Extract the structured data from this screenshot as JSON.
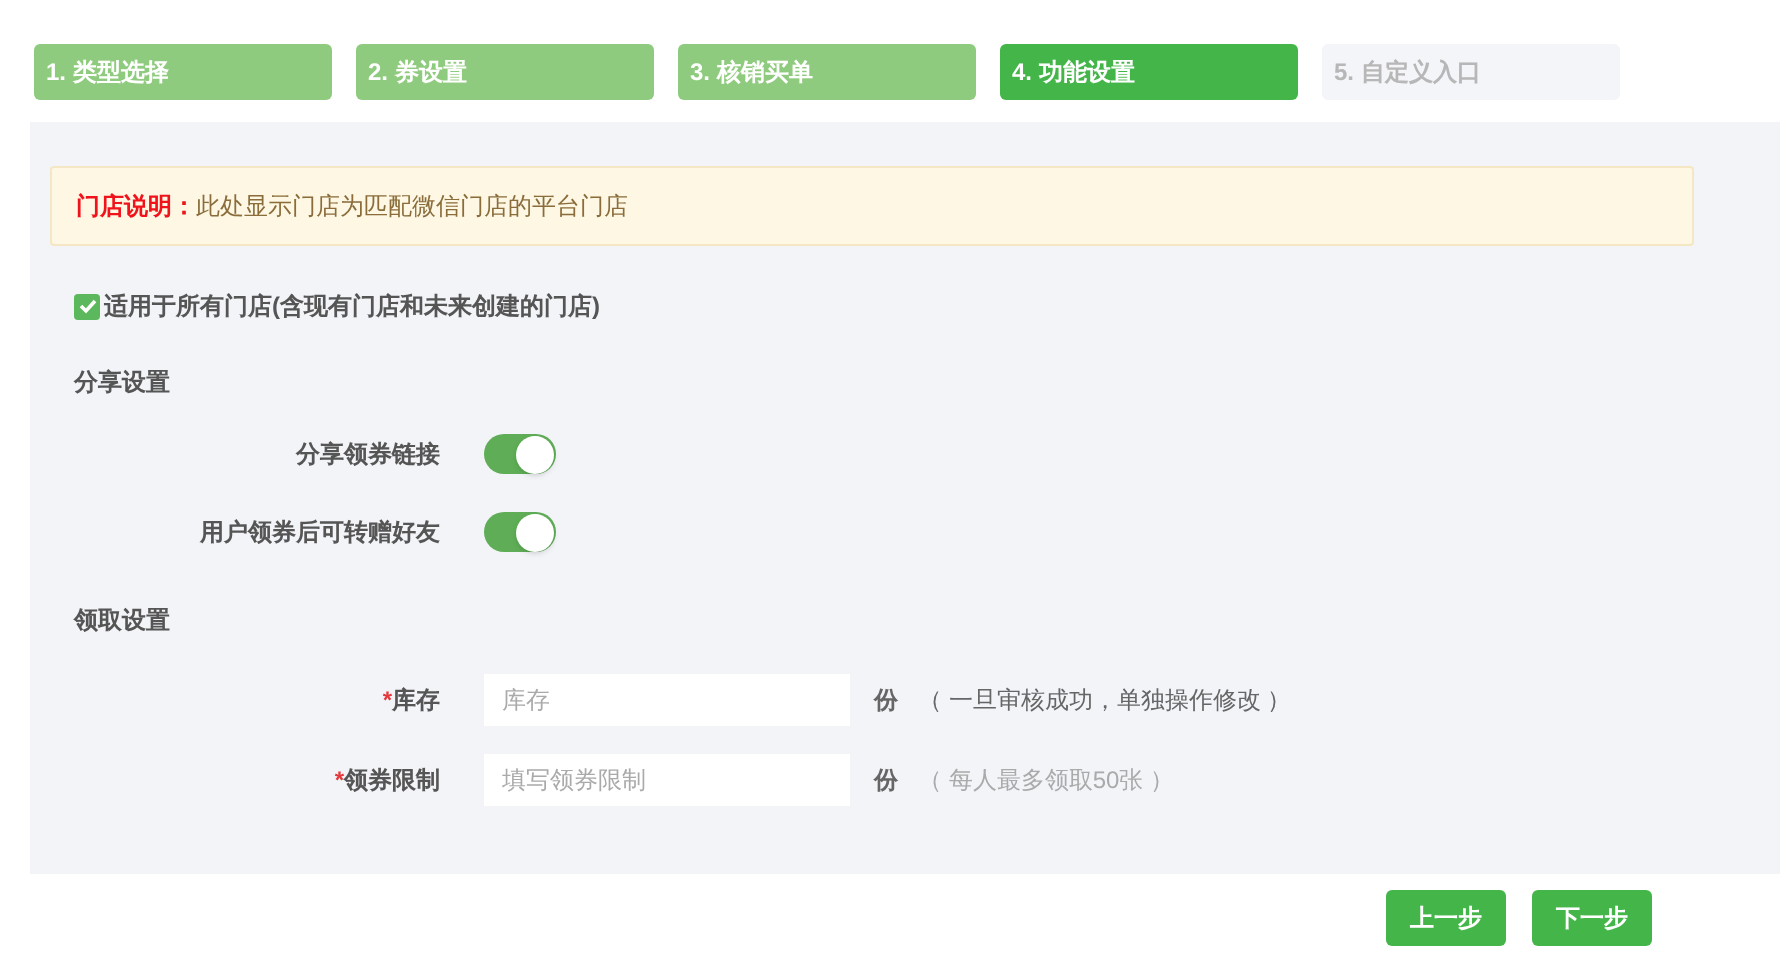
{
  "steps": [
    {
      "label": "1. 类型选择",
      "kind": "done"
    },
    {
      "label": "2. 券设置",
      "kind": "done"
    },
    {
      "label": "3. 核销买单",
      "kind": "done"
    },
    {
      "label": "4. 功能设置",
      "kind": "current"
    },
    {
      "label": "5. 自定义入口",
      "kind": "todo"
    }
  ],
  "notice": {
    "title": "门店说明：",
    "text": "此处显示门店为匹配微信门店的平台门店"
  },
  "all_stores": {
    "label": "适用于所有门店(含现有门店和未来创建的门店)",
    "checked": true
  },
  "share_section": {
    "title": "分享设置",
    "toggles": [
      {
        "label": "分享领券链接",
        "on": true
      },
      {
        "label": "用户领券后可转赠好友",
        "on": true
      }
    ]
  },
  "receive_section": {
    "title": "领取设置",
    "fields": [
      {
        "required_mark": "*",
        "label": "库存",
        "placeholder": "库存",
        "unit": "份",
        "hint": "（ 一旦审核成功，单独操作修改 ）",
        "muted": false
      },
      {
        "required_mark": "*",
        "label": "领券限制",
        "placeholder": "填写领券限制",
        "unit": "份",
        "hint": "（ 每人最多领取50张 ）",
        "muted": true
      }
    ]
  },
  "buttons": [
    "上一步",
    "下一步"
  ]
}
